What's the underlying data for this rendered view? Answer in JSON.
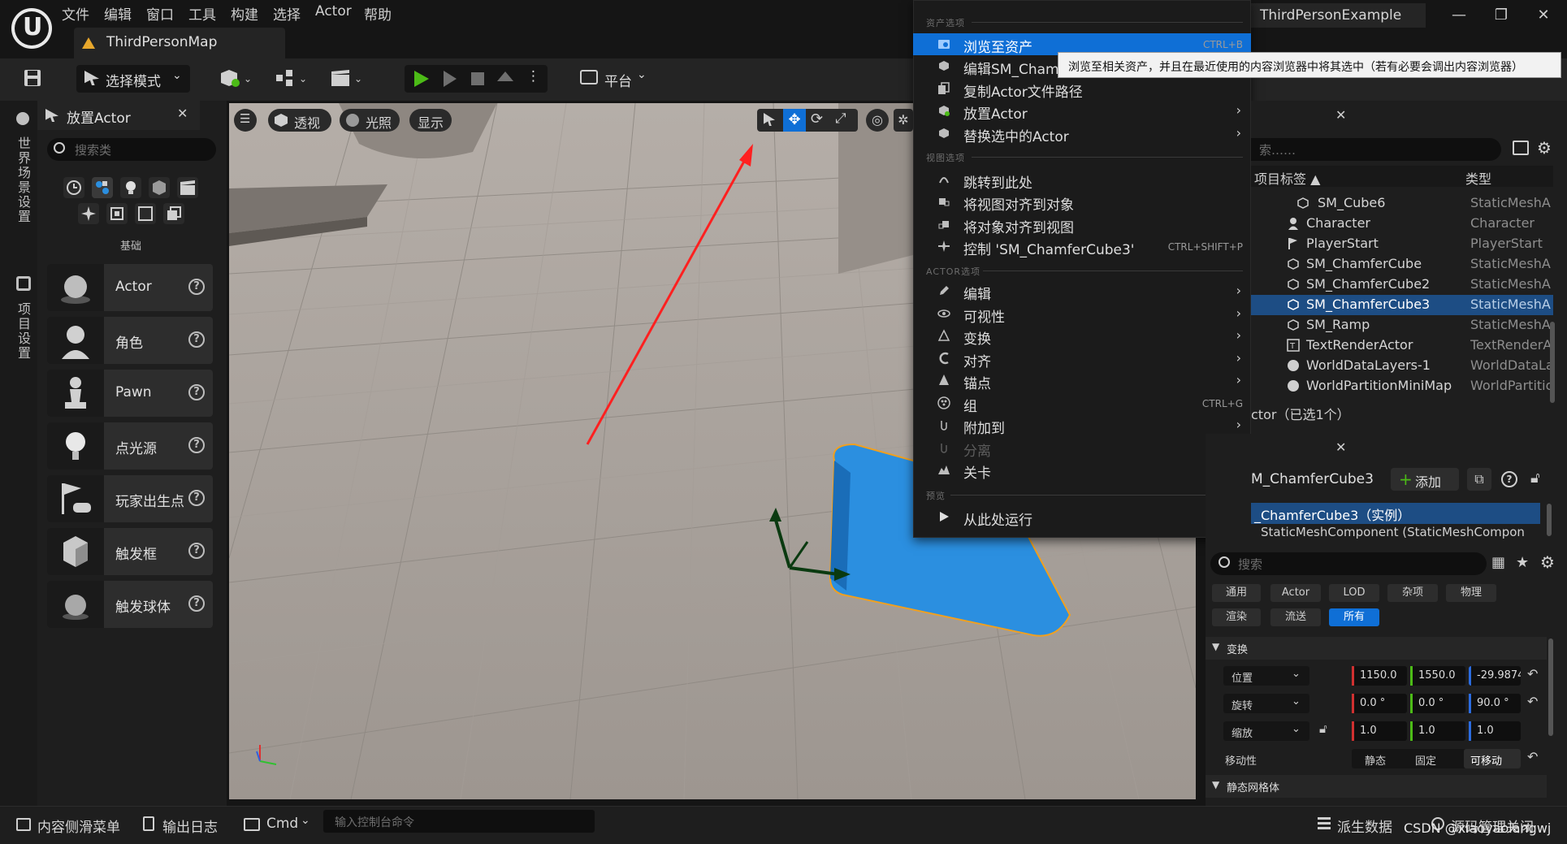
{
  "menu": {
    "items": [
      "文件",
      "编辑",
      "窗口",
      "工具",
      "构建",
      "选择",
      "Actor",
      "帮助"
    ]
  },
  "tab": {
    "map_name": "ThirdPersonMap"
  },
  "project_name": "ThirdPersonExample",
  "toolbar": {
    "select_mode": "选择模式",
    "platform": "平台"
  },
  "left_strip": {
    "world_settings": "世界场景设置",
    "project_settings": "项目设置"
  },
  "place_actor": {
    "title": "放置Actor",
    "search_placeholder": "搜索类",
    "category_label": "基础",
    "items": [
      "Actor",
      "角色",
      "Pawn",
      "点光源",
      "玩家出生点",
      "触发框",
      "触发球体"
    ]
  },
  "viewport": {
    "perspective": "透视",
    "lighting": "光照",
    "show": "显示"
  },
  "context_menu": {
    "sections": {
      "asset": "资产选项",
      "view": "视图选项",
      "actor": "ACTOR选项",
      "preview": "预览"
    },
    "asset_items": [
      {
        "label": "浏览至资产",
        "shortcut": "CTRL+B"
      },
      {
        "label": "编辑SM_ChamferCube",
        "shortcut": ""
      },
      {
        "label": "复制Actor文件路径",
        "shortcut": ""
      },
      {
        "label": "放置Actor",
        "shortcut": ""
      },
      {
        "label": "替换选中的Actor",
        "shortcut": ""
      }
    ],
    "view_items": [
      {
        "label": "跳转到此处",
        "shortcut": ""
      },
      {
        "label": "将视图对齐到对象",
        "shortcut": ""
      },
      {
        "label": "将对象对齐到视图",
        "shortcut": ""
      },
      {
        "label": "控制 'SM_ChamferCube3'",
        "shortcut": "CTRL+SHIFT+P"
      }
    ],
    "actor_items": [
      {
        "label": "编辑",
        "shortcut": ""
      },
      {
        "label": "可视性",
        "shortcut": ""
      },
      {
        "label": "变换",
        "shortcut": ""
      },
      {
        "label": "对齐",
        "shortcut": ""
      },
      {
        "label": "锚点",
        "shortcut": ""
      },
      {
        "label": "组",
        "shortcut": "CTRL+G"
      },
      {
        "label": "附加到",
        "shortcut": ""
      },
      {
        "label": "分离",
        "shortcut": ""
      },
      {
        "label": "关卡",
        "shortcut": ""
      }
    ],
    "preview_items": [
      {
        "label": "从此处运行",
        "shortcut": ""
      }
    ],
    "tooltip": "浏览至相关资产，并且在最近使用的内容浏览器中将其选中（若有必要会调出内容浏览器）"
  },
  "outliner": {
    "search_placeholder": "索……",
    "col_label": "项目标签 ▲",
    "col_type": "类型",
    "rows": [
      {
        "name": "SM_Cube6",
        "type": "StaticMeshA"
      },
      {
        "name": "Character",
        "type": "Character"
      },
      {
        "name": "PlayerStart",
        "type": "PlayerStart"
      },
      {
        "name": "SM_ChamferCube",
        "type": "StaticMeshA"
      },
      {
        "name": "SM_ChamferCube2",
        "type": "StaticMeshA"
      },
      {
        "name": "SM_ChamferCube3",
        "type": "StaticMeshA"
      },
      {
        "name": "SM_Ramp",
        "type": "StaticMeshA"
      },
      {
        "name": "TextRenderActor",
        "type": "TextRenderA"
      },
      {
        "name": "WorldDataLayers-1",
        "type": "WorldDataLa"
      },
      {
        "name": "WorldPartitionMiniMap",
        "type": "WorldPartitio"
      }
    ],
    "status": "ctor（已选1个）"
  },
  "details": {
    "actor_name": "M_ChamferCube3",
    "add_label": "添加",
    "instance_row": "_ChamferCube3（实例）",
    "component_row": "StaticMeshComponent (StaticMeshCompon",
    "search_placeholder": "搜索",
    "tags_row1": [
      "通用",
      "Actor",
      "LOD",
      "杂项",
      "物理"
    ],
    "tags_row2": [
      "渲染",
      "流送",
      "所有"
    ],
    "transform_section": "变换",
    "location_label": "位置",
    "rotation_label": "旋转",
    "scale_label": "缩放",
    "location": [
      "1150.0",
      "1550.0",
      "-29.9874"
    ],
    "rotation": [
      "0.0 °",
      "0.0 °",
      "90.0 °"
    ],
    "scale": [
      "1.0",
      "1.0",
      "1.0"
    ],
    "mobility_label": "移动性",
    "mobility_options": [
      "静态",
      "固定",
      "可移动"
    ],
    "static_mesh_section": "静态网格体"
  },
  "bottombar": {
    "content_drawer": "内容侧滑菜单",
    "output_log": "输出日志",
    "cmd": "Cmd",
    "console_placeholder": "输入控制台命令",
    "derived_data": "派生数据",
    "source_control": "源码管理关闭",
    "watermark": "CSDN @xiaoyaolangwj"
  },
  "colors": {
    "accent": "#0f6fd6",
    "selected_row": "#1d4d84",
    "play_green": "#4cbb17",
    "cube_blue": "#2b8fe0",
    "arrow_red": "#ff2020"
  }
}
